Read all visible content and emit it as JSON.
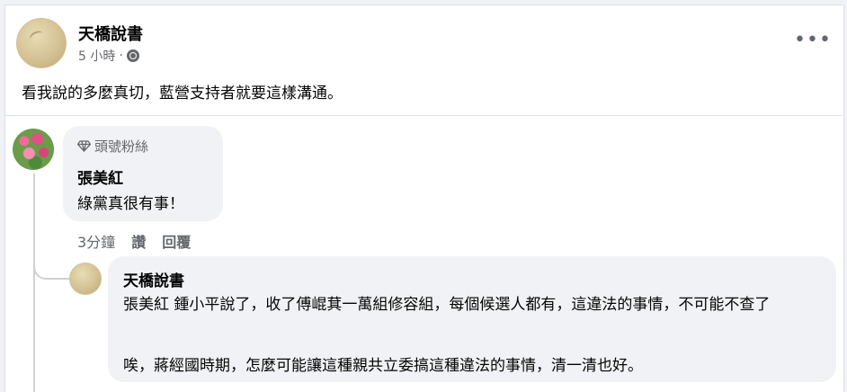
{
  "post": {
    "author": "天橋說書",
    "time": "5 小時",
    "dot": "·",
    "text": "看我說的多麼真切，藍營支持者就要這樣溝通。",
    "more": "•••"
  },
  "comment1": {
    "badge": "頭號粉絲",
    "author": "張美紅",
    "text": "綠黨真很有事！",
    "time": "3分鐘",
    "like_label": "讚",
    "reply_label": "回覆"
  },
  "reply1": {
    "author": "天橋說書",
    "text1": "張美紅 鍾小平說了，收了傅崐萁一萬組修容組，每個候選人都有，這違法的事情，不可能不查了",
    "text2": "唉，蔣經國時期，怎麼可能讓這種親共立委搞這種違法的事情，清一清也好。"
  },
  "icons": {
    "more": "more-dots-icon",
    "privacy": "globe-icon",
    "badge": "diamond-icon"
  }
}
